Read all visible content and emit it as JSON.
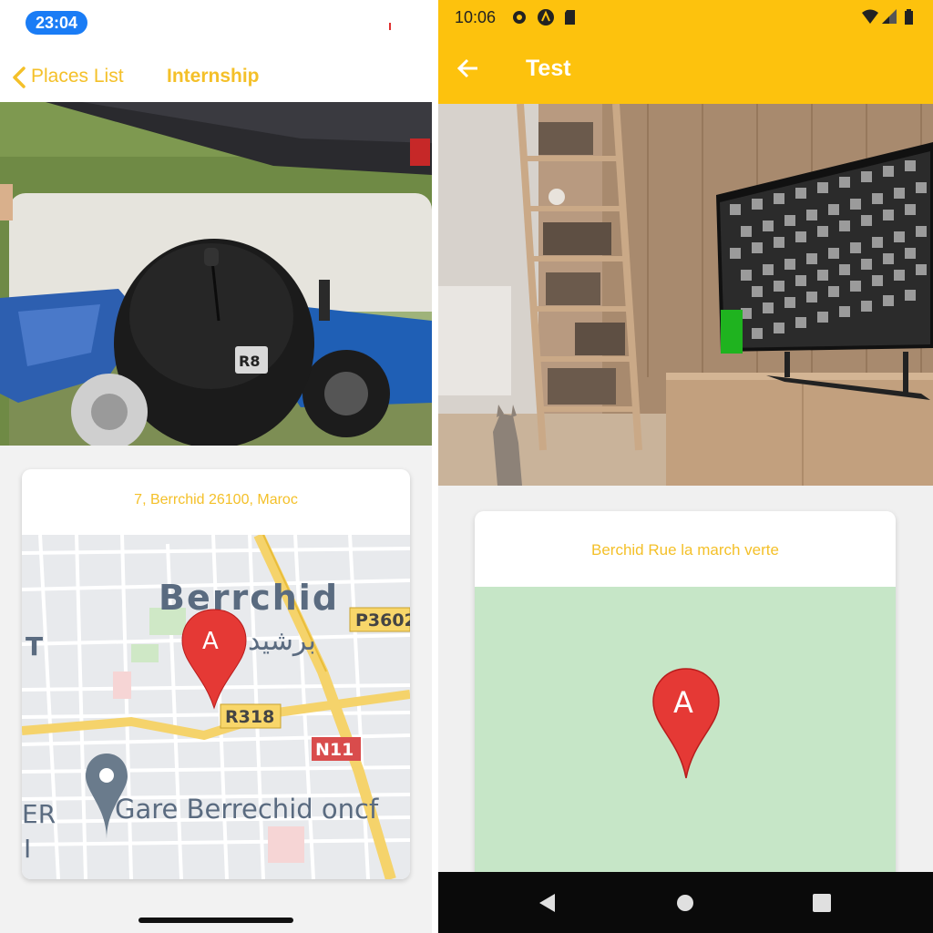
{
  "left_screen": {
    "status_time": "23:04",
    "nav": {
      "back_label": "Places List",
      "title": "Internship"
    },
    "card": {
      "address": "7, Berrchid 26100, Maroc"
    },
    "map": {
      "city_label": "Berrchid",
      "city_label_arabic": "برشيد",
      "marker_label": "A",
      "road_labels": [
        "P3602",
        "R318",
        "N11"
      ],
      "place_label": "Gare Berrechid oncf",
      "edge_labels": [
        "T",
        "ER",
        "I"
      ]
    },
    "photo_mouse_badge": "R8"
  },
  "right_screen": {
    "status_time": "10:06",
    "appbar_title": "Test",
    "card": {
      "address": "Berchid Rue la march verte"
    },
    "map": {
      "marker_label": "A"
    },
    "colors": {
      "appbar": "#fdc20d",
      "map_fill": "#c6e6c7",
      "marker": "#e53935"
    }
  },
  "colors": {
    "accent": "#f4c029",
    "ios_time_pill": "#1a7cf5"
  },
  "icons": [
    "back-chevron-icon",
    "settings-icon",
    "a-logo-icon",
    "sd-card-icon",
    "wifi-icon",
    "signal-icon",
    "battery-icon",
    "back-arrow-icon",
    "nav-back-icon",
    "nav-home-icon",
    "nav-recents-icon",
    "map-pin-icon"
  ]
}
